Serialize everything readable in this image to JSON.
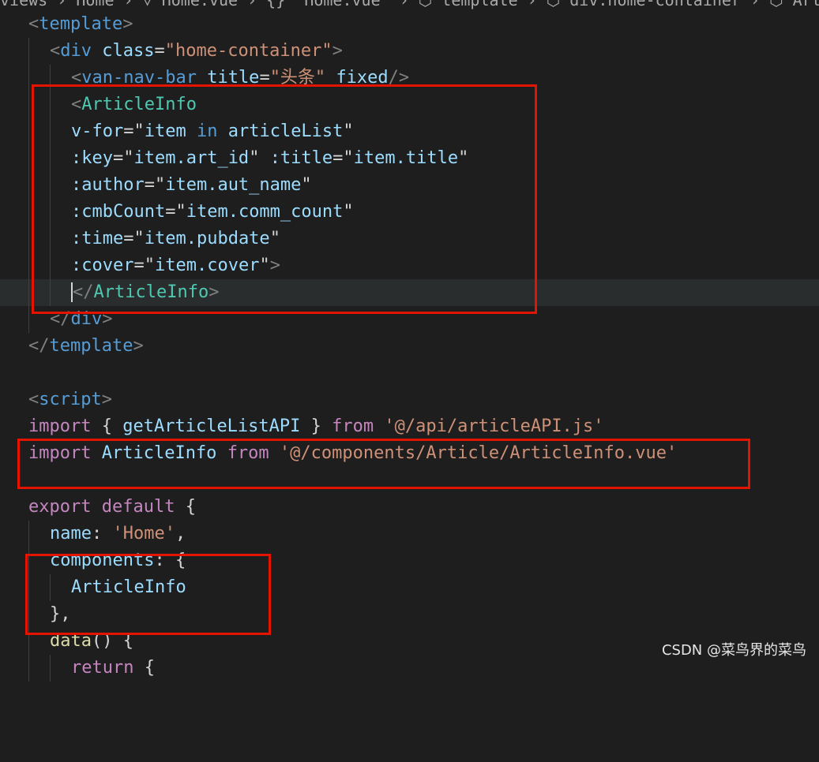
{
  "breadcrumb": "views › Home › ▽ Home.vue › {} \"Home.vue\" › ⬡ template › ⬡ div.home-container › ⬡ Artic",
  "code": {
    "l1_open": "<",
    "l1_tag": "template",
    "l1_close": ">",
    "l2_open": "<",
    "l2_tag": "div",
    "l2_attr": "class",
    "l2_eq": "=",
    "l2_val": "\"home-container\"",
    "l2_close": ">",
    "l3_open": "<",
    "l3_tag": "van-nav-bar",
    "l3_attr1": "title",
    "l3_eq": "=",
    "l3_val": "\"头条\"",
    "l3_attr2": "fixed",
    "l3_close": "/>",
    "l4_open": "<",
    "l4_tag": "ArticleInfo",
    "l5_attr": "v-for",
    "l5_eq": "=\"",
    "l5_v1": "item",
    "l5_in": "in",
    "l5_v2": "articleList",
    "l5_q": "\"",
    "l6_attr1": ":key",
    "l6_eq1": "=\"",
    "l6_v1": "item.art_id",
    "l6_q1": "\"",
    "l6_attr2": ":title",
    "l6_eq2": "=\"",
    "l6_v2": "item.title",
    "l6_q2": "\"",
    "l7_attr": ":author",
    "l7_eq": "=\"",
    "l7_v": "item.aut_name",
    "l7_q": "\"",
    "l8_attr": ":cmbCount",
    "l8_eq": "=\"",
    "l8_v": "item.comm_count",
    "l8_q": "\"",
    "l9_attr": ":time",
    "l9_eq": "=\"",
    "l9_v": "item.pubdate",
    "l9_q": "\"",
    "l10_attr": ":cover",
    "l10_eq": "=\"",
    "l10_v": "item.cover",
    "l10_q": "\"",
    "l10_close": ">",
    "l11_open": "</",
    "l11_tag": "ArticleInfo",
    "l11_close": ">",
    "l12_open": "</",
    "l12_tag": "div",
    "l12_close": ">",
    "l13_open": "</",
    "l13_tag": "template",
    "l13_close": ">",
    "l15_open": "<",
    "l15_tag": "script",
    "l15_close": ">",
    "l16_kw": "import",
    "l16_b1": "{",
    "l16_id": "getArticleListAPI",
    "l16_b2": "}",
    "l16_from": "from",
    "l16_str": "'@/api/articleAPI.js'",
    "l17_kw": "import",
    "l17_id": "ArticleInfo",
    "l17_from": "from",
    "l17_str": "'@/components/Article/ArticleInfo.vue'",
    "l19_kw1": "export",
    "l19_kw2": "default",
    "l19_b": "{",
    "l20_prop": "name",
    "l20_colon": ":",
    "l20_str": "'Home'",
    "l20_comma": ",",
    "l21_prop": "components",
    "l21_colon": ":",
    "l21_b": "{",
    "l22_id": "ArticleInfo",
    "l23_b": "},",
    "l24_fn": "data",
    "l24_paren": "()",
    "l24_b": "{",
    "l25_kw": "return",
    "l25_b": "{"
  },
  "watermark": "CSDN @菜鸟界的菜鸟"
}
